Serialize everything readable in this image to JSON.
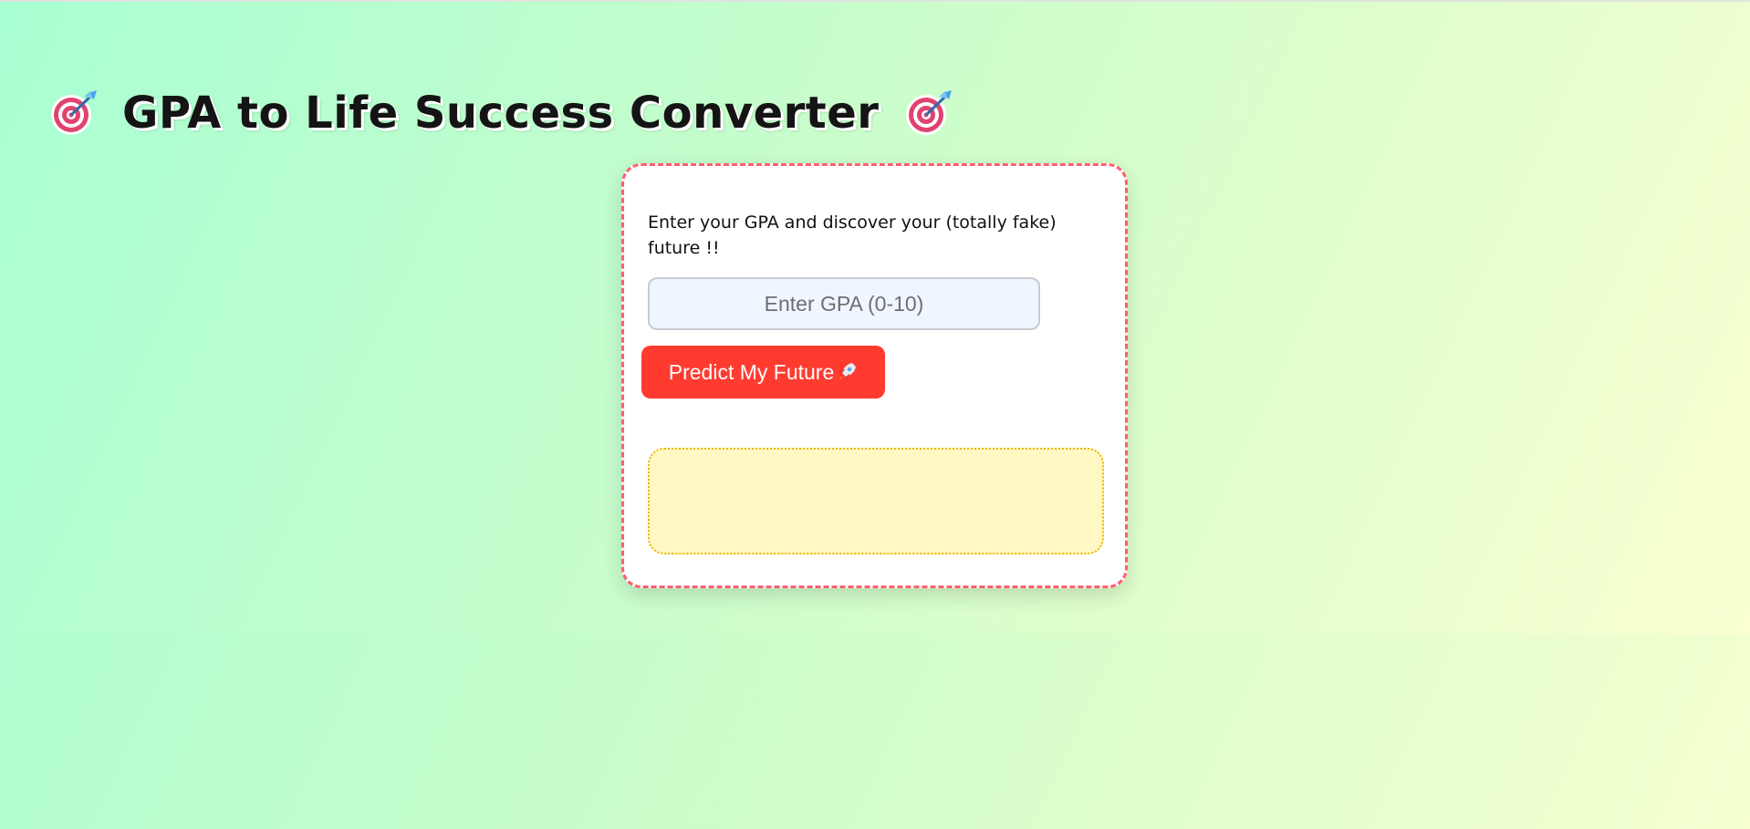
{
  "page": {
    "title": "GPA to Life Success Converter",
    "title_icon": "target-icon"
  },
  "card": {
    "description": "Enter your GPA and discover your (totally fake) future !!",
    "gpa_input": {
      "value": "",
      "placeholder": "Enter GPA (0-10)"
    },
    "predict_button": {
      "label": "Predict My Future",
      "icon": "rocket-icon"
    },
    "result_text": ""
  },
  "colors": {
    "accent_red": "#ff3b30",
    "card_border": "#ff5f6d",
    "result_bg": "#fff8c4",
    "result_border": "#f0b400",
    "input_bg": "#eff6ff"
  }
}
